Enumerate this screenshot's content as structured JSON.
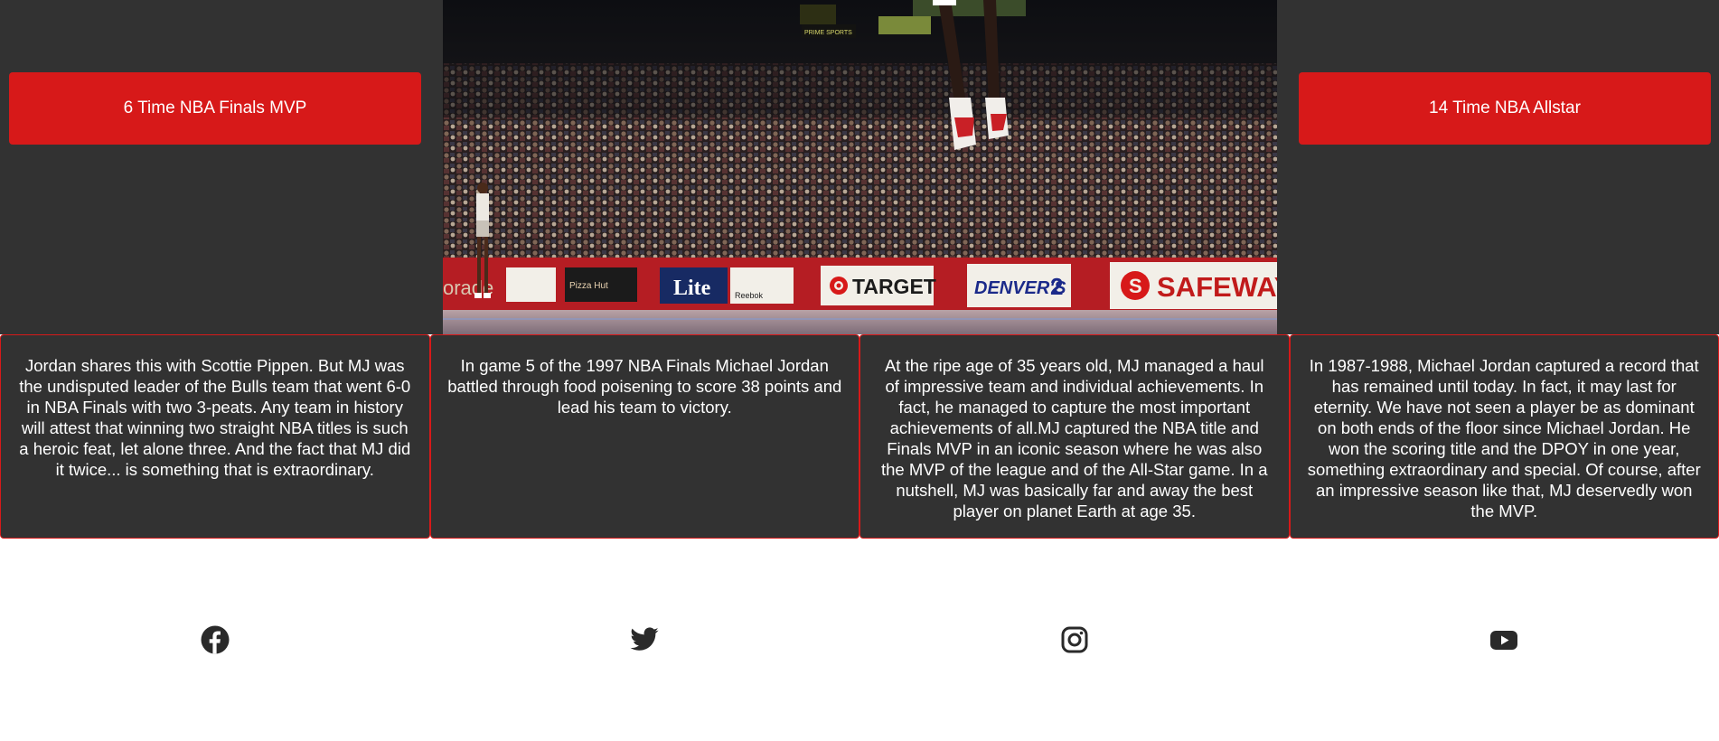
{
  "hero": {
    "left_button": "6 Time NBA Finals MVP",
    "right_button": "14 Time NBA Allstar",
    "photo": {
      "signs": [
        "PRIME SPORTS NETWORK",
        "Pizza Hut",
        "Lite",
        "Reebok",
        "TARGET",
        "DENVER'S 2",
        "SAFEWAY"
      ]
    }
  },
  "cards": [
    {
      "text": "Jordan shares this with Scottie Pippen. But MJ was the undisputed leader of the Bulls team that went 6-0 in NBA Finals with two 3-peats. Any team in history will attest that winning two straight NBA titles is such a heroic feat, let alone three. And the fact that MJ did it twice... is something that is extraordinary."
    },
    {
      "text": "In game 5 of the 1997 NBA Finals Michael Jordan battled through food poisening to score 38 points and lead his team to victory."
    },
    {
      "text": "At the ripe age of 35 years old, MJ managed a haul of impressive team and individual achievements. In fact, he managed to capture the most important achievements of all.MJ captured the NBA title and Finals MVP in an iconic season where he was also the MVP of the league and of the All-Star game. In a nutshell, MJ was basically far and away the best player on planet Earth at age 35."
    },
    {
      "text": "In 1987-1988, Michael Jordan captured a record that has remained until today. In fact, it may last for eternity. We have not seen a player be as dominant on both ends of the floor since Michael Jordan. He won the scoring title and the DPOY in one year, something extraordinary and special. Of course, after an impressive season like that, MJ deservedly won the MVP."
    }
  ],
  "social": {
    "icons": [
      "facebook-icon",
      "twitter-icon",
      "instagram-icon",
      "youtube-icon"
    ],
    "icon_color": "#2a2a2a"
  },
  "colors": {
    "accent": "#d71919",
    "panel": "#323232"
  }
}
